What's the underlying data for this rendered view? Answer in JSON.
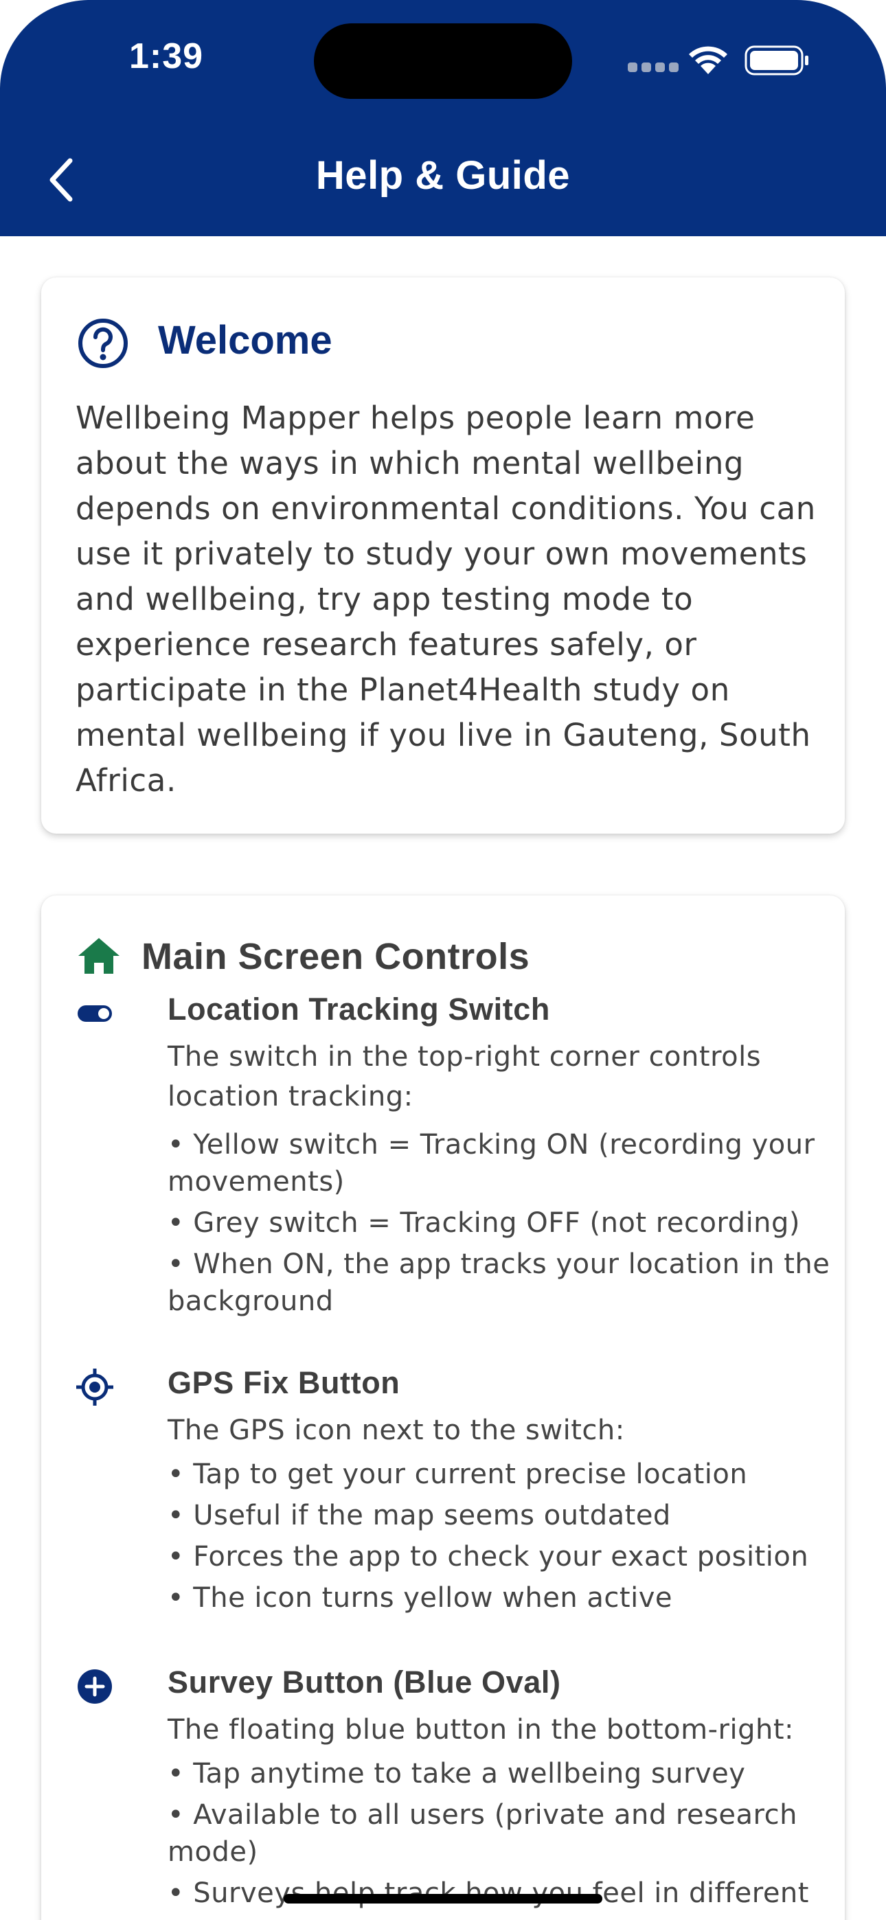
{
  "status_bar": {
    "time": "1:39"
  },
  "header": {
    "title": "Help & Guide"
  },
  "welcome": {
    "title": "Welcome",
    "body": "Wellbeing Mapper helps people learn more about the ways in which mental wellbeing depends on environmental conditions. You can use it privately to study your own movements and wellbeing, try app testing mode to experience research features safely, or participate in the Planet4Health study on mental wellbeing if you live in Gauteng, South Africa."
  },
  "main_controls": {
    "title": "Main Screen Controls",
    "sections": [
      {
        "title": "Location Tracking Switch",
        "intro": "The switch in the top-right corner controls location tracking:",
        "bullets": [
          "• Yellow switch = Tracking ON (recording your movements)",
          "• Grey switch = Tracking OFF (not recording)",
          "• When ON, the app tracks your location in the background"
        ]
      },
      {
        "title": "GPS Fix Button",
        "intro": "The GPS icon next to the switch:",
        "bullets": [
          "• Tap to get your current precise location",
          "• Useful if the map seems outdated",
          "• Forces the app to check your exact position",
          "• The icon turns yellow when active"
        ]
      },
      {
        "title": "Survey Button (Blue Oval)",
        "intro": "The floating blue button in the bottom-right:",
        "bullets": [
          "• Tap anytime to take a wellbeing survey",
          "• Available to all users (private and research mode)",
          "• Surveys help track how you feel in different"
        ]
      }
    ]
  },
  "colors": {
    "header_bg": "#063080",
    "welcome_title": "#0a2d78",
    "home_icon": "#1a7a4a",
    "icon_navy": "#0a2d78"
  },
  "icons": {
    "back": "chevron-left-icon",
    "welcome": "help-circle-icon",
    "main_controls": "home-icon",
    "location_tracking": "toggle-switch-icon",
    "gps": "gps-fixed-icon",
    "survey": "add-circle-icon"
  }
}
